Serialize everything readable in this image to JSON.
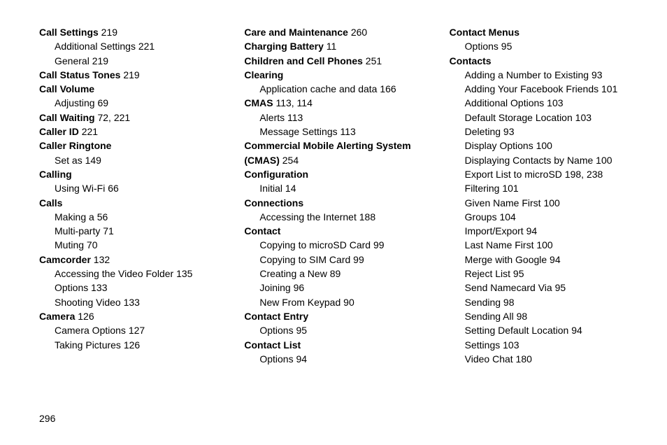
{
  "page_number": "296",
  "columns": [
    [
      {
        "type": "topic",
        "bold": "Call Settings",
        "pages": "219"
      },
      {
        "type": "sub",
        "text": "Additional Settings",
        "pages": "221"
      },
      {
        "type": "sub",
        "text": "General",
        "pages": "219"
      },
      {
        "type": "topic",
        "bold": "Call Status Tones",
        "pages": "219"
      },
      {
        "type": "topic",
        "bold": "Call Volume",
        "pages": ""
      },
      {
        "type": "sub",
        "text": "Adjusting",
        "pages": "69"
      },
      {
        "type": "topic",
        "bold": "Call Waiting",
        "pages": "72, 221"
      },
      {
        "type": "topic",
        "bold": "Caller ID",
        "pages": "221"
      },
      {
        "type": "topic",
        "bold": "Caller Ringtone",
        "pages": ""
      },
      {
        "type": "sub",
        "text": "Set as",
        "pages": "149"
      },
      {
        "type": "topic",
        "bold": "Calling",
        "pages": ""
      },
      {
        "type": "sub",
        "text": "Using Wi-Fi",
        "pages": "66"
      },
      {
        "type": "topic",
        "bold": "Calls",
        "pages": ""
      },
      {
        "type": "sub",
        "text": "Making a",
        "pages": "56"
      },
      {
        "type": "sub",
        "text": "Multi-party",
        "pages": "71"
      },
      {
        "type": "sub",
        "text": "Muting",
        "pages": "70"
      },
      {
        "type": "topic",
        "bold": "Camcorder",
        "pages": "132"
      },
      {
        "type": "sub",
        "text": "Accessing the Video Folder",
        "pages": "135"
      },
      {
        "type": "sub",
        "text": "Options",
        "pages": "133"
      },
      {
        "type": "sub",
        "text": "Shooting Video",
        "pages": "133"
      },
      {
        "type": "topic",
        "bold": "Camera",
        "pages": "126"
      },
      {
        "type": "sub",
        "text": "Camera Options",
        "pages": "127"
      },
      {
        "type": "sub",
        "text": "Taking Pictures",
        "pages": "126"
      }
    ],
    [
      {
        "type": "topic",
        "bold": "Care and Maintenance",
        "pages": "260"
      },
      {
        "type": "topic",
        "bold": "Charging Battery",
        "pages": "11"
      },
      {
        "type": "topic",
        "bold": "Children and Cell Phones",
        "pages": "251"
      },
      {
        "type": "topic",
        "bold": "Clearing",
        "pages": ""
      },
      {
        "type": "sub",
        "text": "Application cache and data",
        "pages": "166"
      },
      {
        "type": "topic",
        "bold": "CMAS",
        "pages": "113, 114"
      },
      {
        "type": "sub",
        "text": "Alerts",
        "pages": "113"
      },
      {
        "type": "sub",
        "text": "Message Settings",
        "pages": "113"
      },
      {
        "type": "topic",
        "bold": "Commercial Mobile Alerting System (CMAS)",
        "pages": "254"
      },
      {
        "type": "topic",
        "bold": "Configuration",
        "pages": ""
      },
      {
        "type": "sub",
        "text": "Initial",
        "pages": "14"
      },
      {
        "type": "topic",
        "bold": "Connections",
        "pages": ""
      },
      {
        "type": "sub",
        "text": "Accessing the Internet",
        "pages": "188"
      },
      {
        "type": "topic",
        "bold": "Contact",
        "pages": ""
      },
      {
        "type": "sub",
        "text": "Copying to microSD Card",
        "pages": "99"
      },
      {
        "type": "sub",
        "text": "Copying to SIM Card",
        "pages": "99"
      },
      {
        "type": "sub",
        "text": "Creating a New",
        "pages": "89"
      },
      {
        "type": "sub",
        "text": "Joining",
        "pages": "96"
      },
      {
        "type": "sub",
        "text": "New From Keypad",
        "pages": "90"
      },
      {
        "type": "topic",
        "bold": "Contact Entry",
        "pages": ""
      },
      {
        "type": "sub",
        "text": "Options",
        "pages": "95"
      },
      {
        "type": "topic",
        "bold": "Contact List",
        "pages": ""
      },
      {
        "type": "sub",
        "text": "Options",
        "pages": "94"
      }
    ],
    [
      {
        "type": "topic",
        "bold": "Contact Menus",
        "pages": ""
      },
      {
        "type": "sub",
        "text": "Options",
        "pages": "95"
      },
      {
        "type": "topic",
        "bold": "Contacts",
        "pages": ""
      },
      {
        "type": "sub",
        "text": "Adding a Number to Existing",
        "pages": "93"
      },
      {
        "type": "sub",
        "text": "Adding Your Facebook Friends",
        "pages": "101"
      },
      {
        "type": "sub",
        "text": "Additional Options",
        "pages": "103"
      },
      {
        "type": "sub",
        "text": "Default Storage Location",
        "pages": "103"
      },
      {
        "type": "sub",
        "text": "Deleting",
        "pages": "93"
      },
      {
        "type": "sub",
        "text": "Display Options",
        "pages": "100"
      },
      {
        "type": "sub",
        "text": "Displaying Contacts by Name",
        "pages": "100"
      },
      {
        "type": "sub",
        "text": "Export List to microSD",
        "pages": "198, 238"
      },
      {
        "type": "sub",
        "text": "Filtering",
        "pages": "101"
      },
      {
        "type": "sub",
        "text": "Given Name First",
        "pages": "100"
      },
      {
        "type": "sub",
        "text": "Groups",
        "pages": "104"
      },
      {
        "type": "sub",
        "text": "Import/Export",
        "pages": "94"
      },
      {
        "type": "sub",
        "text": "Last Name First",
        "pages": "100"
      },
      {
        "type": "sub",
        "text": "Merge with Google",
        "pages": "94"
      },
      {
        "type": "sub",
        "text": "Reject List",
        "pages": "95"
      },
      {
        "type": "sub",
        "text": "Send Namecard Via",
        "pages": "95"
      },
      {
        "type": "sub",
        "text": "Sending",
        "pages": "98"
      },
      {
        "type": "sub",
        "text": "Sending All",
        "pages": "98"
      },
      {
        "type": "sub",
        "text": "Setting Default Location",
        "pages": "94"
      },
      {
        "type": "sub",
        "text": "Settings",
        "pages": "103"
      },
      {
        "type": "sub",
        "text": "Video Chat",
        "pages": "180"
      }
    ]
  ]
}
